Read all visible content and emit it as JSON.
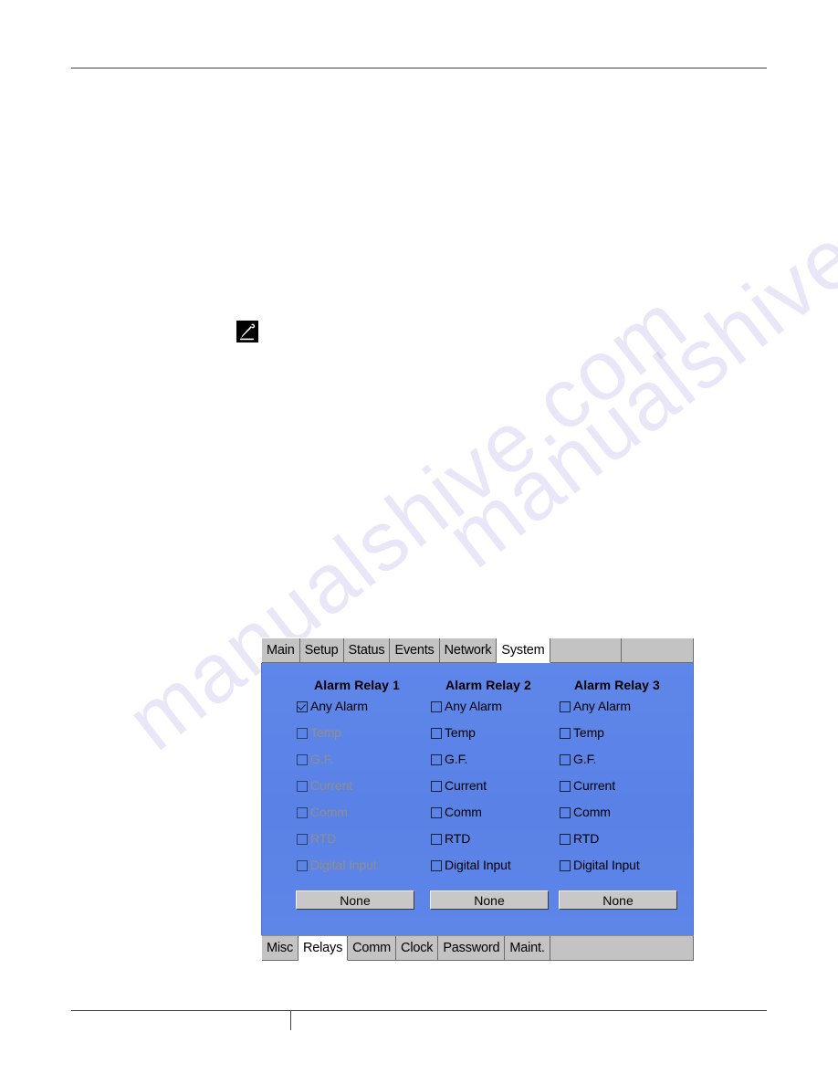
{
  "page": {
    "watermark_text": "manualshive.com",
    "note_icon": "note-pen-icon"
  },
  "device": {
    "top_tabs": [
      {
        "label": "Main",
        "active": false
      },
      {
        "label": "Setup",
        "active": false
      },
      {
        "label": "Status",
        "active": false
      },
      {
        "label": "Events",
        "active": false
      },
      {
        "label": "Network",
        "active": false
      },
      {
        "label": "System",
        "active": true
      }
    ],
    "top_tab_fillers": 2,
    "bottom_tabs": [
      {
        "label": "Misc",
        "active": false
      },
      {
        "label": "Relays",
        "active": true
      },
      {
        "label": "Comm",
        "active": false
      },
      {
        "label": "Clock",
        "active": false
      },
      {
        "label": "Password",
        "active": false
      },
      {
        "label": "Maint.",
        "active": false
      }
    ],
    "bottom_tab_fillers": 1,
    "colors": {
      "panel_background": "#5b84e8",
      "tab_background": "#c3c3c3",
      "tab_active_background": "#ffffff",
      "button_face": "#c8c8c8",
      "disabled_text": "#9b9078",
      "watermark": "#5b4fc4"
    },
    "relays": [
      {
        "title": "Alarm Relay 1",
        "button_label": "None",
        "options": [
          {
            "label": "Any Alarm",
            "checked": true,
            "disabled": false
          },
          {
            "label": "Temp",
            "checked": false,
            "disabled": true
          },
          {
            "label": "G.F.",
            "checked": false,
            "disabled": true
          },
          {
            "label": "Current",
            "checked": false,
            "disabled": true
          },
          {
            "label": "Comm",
            "checked": false,
            "disabled": true
          },
          {
            "label": "RTD",
            "checked": false,
            "disabled": true
          },
          {
            "label": "Digital Input",
            "checked": false,
            "disabled": true
          }
        ]
      },
      {
        "title": "Alarm Relay 2",
        "button_label": "None",
        "options": [
          {
            "label": "Any Alarm",
            "checked": false,
            "disabled": false
          },
          {
            "label": "Temp",
            "checked": false,
            "disabled": false
          },
          {
            "label": "G.F.",
            "checked": false,
            "disabled": false
          },
          {
            "label": "Current",
            "checked": false,
            "disabled": false
          },
          {
            "label": "Comm",
            "checked": false,
            "disabled": false
          },
          {
            "label": "RTD",
            "checked": false,
            "disabled": false
          },
          {
            "label": "Digital Input",
            "checked": false,
            "disabled": false
          }
        ]
      },
      {
        "title": "Alarm Relay 3",
        "button_label": "None",
        "options": [
          {
            "label": "Any Alarm",
            "checked": false,
            "disabled": false
          },
          {
            "label": "Temp",
            "checked": false,
            "disabled": false
          },
          {
            "label": "G.F.",
            "checked": false,
            "disabled": false
          },
          {
            "label": "Current",
            "checked": false,
            "disabled": false
          },
          {
            "label": "Comm",
            "checked": false,
            "disabled": false
          },
          {
            "label": "RTD",
            "checked": false,
            "disabled": false
          },
          {
            "label": "Digital Input",
            "checked": false,
            "disabled": false
          }
        ]
      }
    ]
  }
}
